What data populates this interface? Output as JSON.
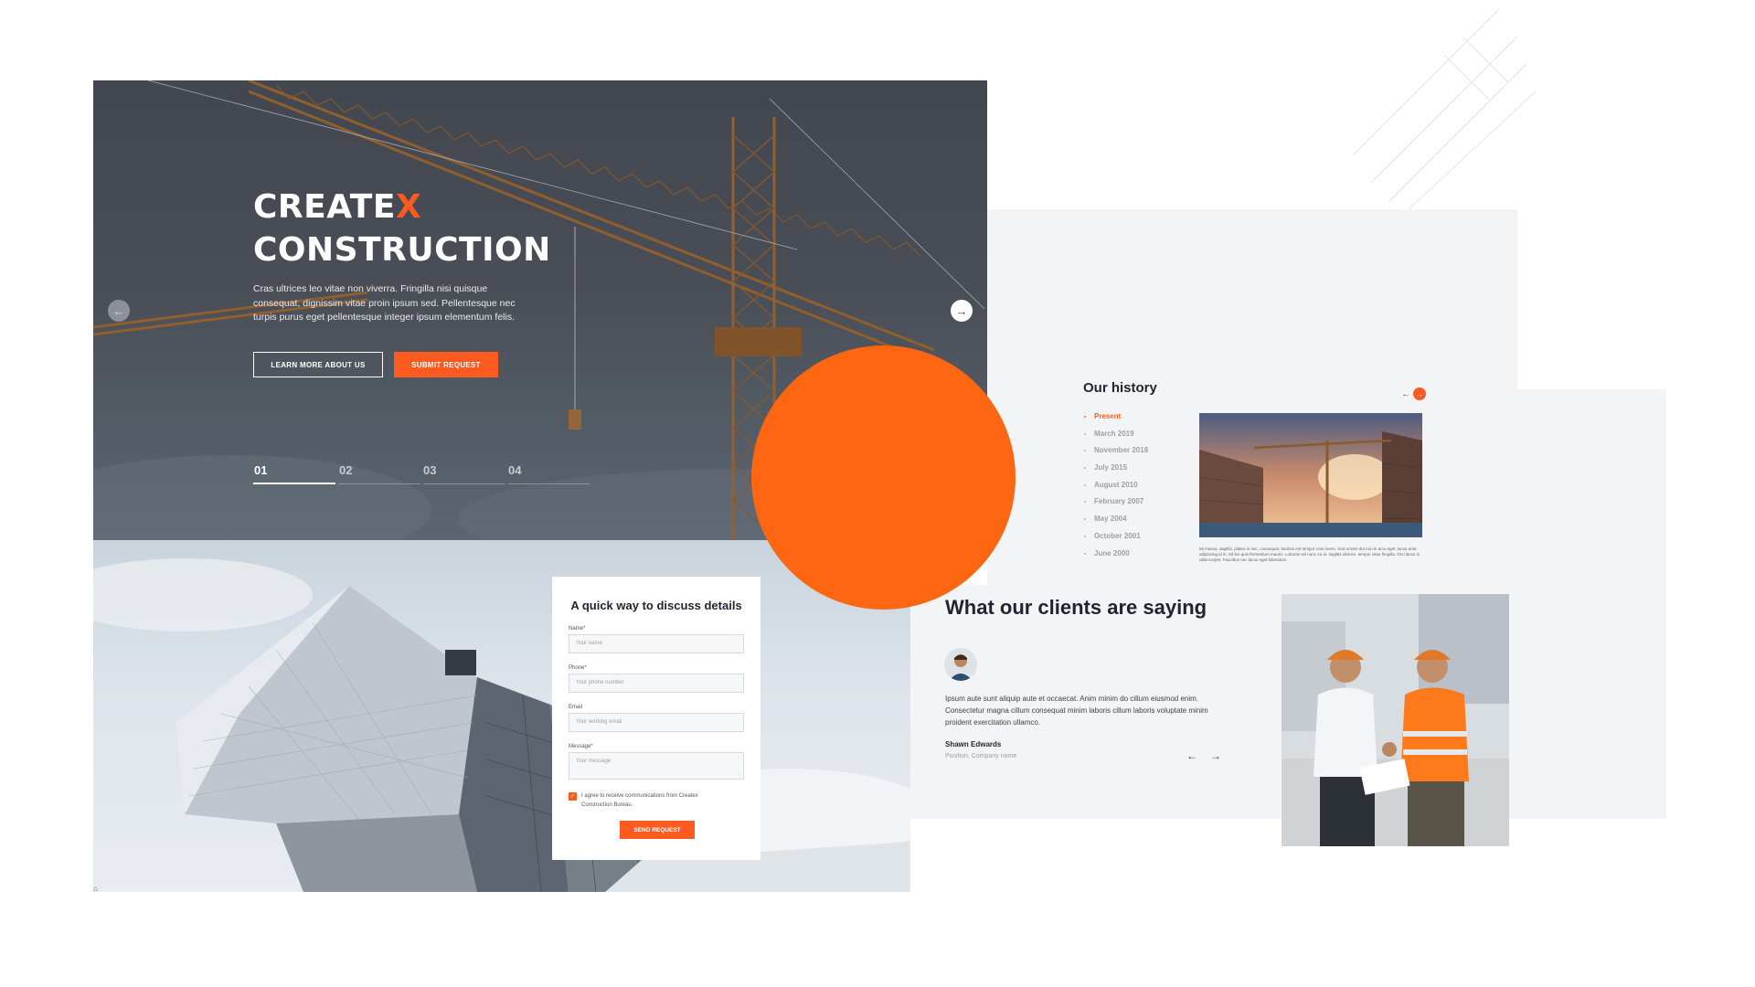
{
  "hero": {
    "title_line1_main": "CREATE",
    "title_line1_accent": "X",
    "title_line2": "CONSTRUCTION",
    "description": "Cras ultrices leo vitae non viverra. Fringilla nisi quisque consequat, dignissim vitae proin ipsum sed. Pellentesque nec turpis purus eget pellentesque integer ipsum elementum felis.",
    "learn_button": "LEARN MORE ABOUT US",
    "submit_button": "SUBMIT REQUEST",
    "slides": [
      "01",
      "02",
      "03",
      "04"
    ],
    "active_slide": "01",
    "prev_icon": "arrow-left-icon",
    "next_icon": "arrow-right-icon"
  },
  "form": {
    "title": "A quick way to discuss details",
    "name_label": "Name*",
    "name_placeholder": "Your name",
    "phone_label": "Phone*",
    "phone_placeholder": "Your phone number",
    "email_label": "Email",
    "email_placeholder": "Your working email",
    "message_label": "Message*",
    "message_placeholder": "Your message",
    "consent": "I agree to receive communications from Createx Construction Bureau.",
    "consent_checked": true,
    "send_button": "SEND REQUEST"
  },
  "history": {
    "title": "Our history",
    "timeline": [
      "Present",
      "March 2019",
      "November 2018",
      "July 2015",
      "August 2010",
      "February 2007",
      "May 2004",
      "October 2001",
      "June 2000"
    ],
    "active": "Present",
    "caption": "Mi massa, sagittis, platea in nec, consequat, facilisis est tempor cras lorem. Sed ornare dui non in arcu eget, lacus ante, adipiscing id in. Sit leo quis fermentum mauris. Lobortis vel nunc eu in, sagittis ultrices, tempor vitae fringilla. Orci lacus in ullamcorper. Faucibus nec lacus eget bibendum."
  },
  "clients": {
    "title": "What our clients are saying",
    "quote": "Ipsum aute sunt aliquip aute et occaecat. Anim minim do cillum eiusmod enim. Consectetur magna cillum consequat minim laboris cillum laboris voluptate minim proident exercitation ullamco.",
    "name": "Shawn Edwards",
    "position": "Position, Company name",
    "prev_icon": "arrow-left-icon",
    "next_icon": "arrow-right-icon"
  },
  "colors": {
    "accent": "#ff5a1f",
    "circle": "#ff6611",
    "panel": "#f3f4f6",
    "text": "#1f2430"
  }
}
